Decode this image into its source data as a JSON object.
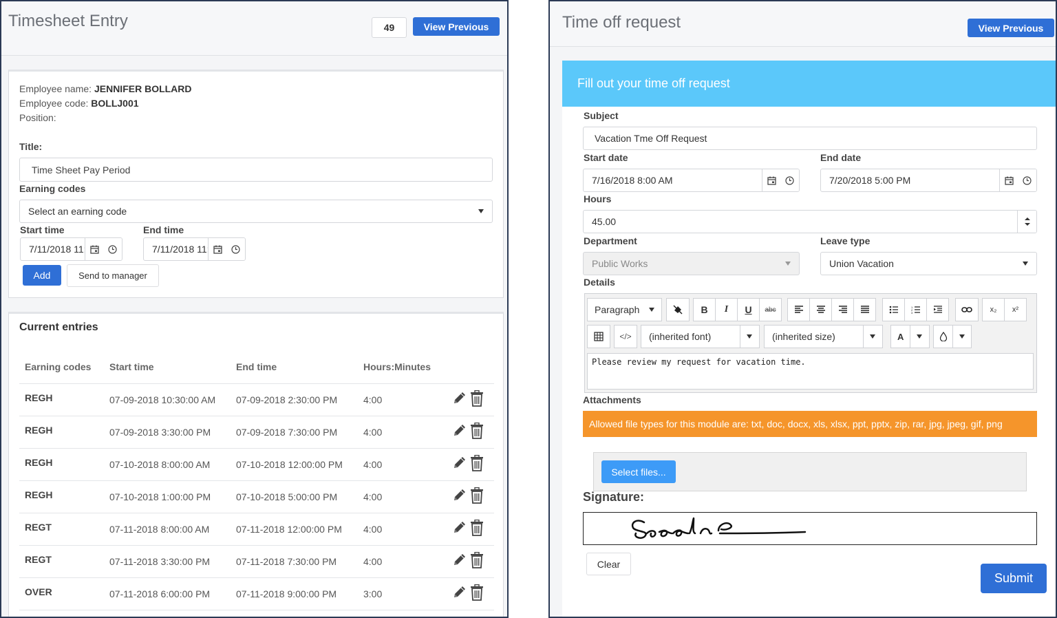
{
  "timesheet": {
    "title": "Timesheet Entry",
    "count": "49",
    "view_previous": "View Previous",
    "employee_name_label": "Employee name:",
    "employee_name": "JENNIFER BOLLARD",
    "employee_code_label": "Employee code:",
    "employee_code": "BOLLJ001",
    "position_label": "Position:",
    "title_label": "Title:",
    "title_value": "Time Sheet Pay Period",
    "earning_codes_label": "Earning codes",
    "earning_codes_placeholder": "Select an earning code",
    "start_time_label": "Start time",
    "start_time_value": "7/11/2018 11:",
    "end_time_label": "End time",
    "end_time_value": "7/11/2018 11:",
    "add_label": "Add",
    "send_label": "Send to manager",
    "current_entries_label": "Current entries",
    "columns": [
      "Earning codes",
      "Start time",
      "End time",
      "Hours:Minutes"
    ],
    "rows": [
      {
        "code": "REGH",
        "start": "07-09-2018 10:30:00 AM",
        "end": "07-09-2018 2:30:00 PM",
        "hours": "4:00"
      },
      {
        "code": "REGH",
        "start": "07-09-2018 3:30:00 PM",
        "end": "07-09-2018 7:30:00 PM",
        "hours": "4:00"
      },
      {
        "code": "REGH",
        "start": "07-10-2018 8:00:00 AM",
        "end": "07-10-2018 12:00:00 PM",
        "hours": "4:00"
      },
      {
        "code": "REGH",
        "start": "07-10-2018 1:00:00 PM",
        "end": "07-10-2018 5:00:00 PM",
        "hours": "4:00"
      },
      {
        "code": "REGT",
        "start": "07-11-2018 8:00:00 AM",
        "end": "07-11-2018 12:00:00 PM",
        "hours": "4:00"
      },
      {
        "code": "REGT",
        "start": "07-11-2018 3:30:00 PM",
        "end": "07-11-2018 7:30:00 PM",
        "hours": "4:00"
      },
      {
        "code": "OVER",
        "start": "07-11-2018 6:00:00 PM",
        "end": "07-11-2018 9:00:00 PM",
        "hours": "3:00"
      }
    ]
  },
  "timeoff": {
    "title": "Time off request",
    "view_previous": "View Previous",
    "banner": "Fill out your time off request",
    "subject_label": "Subject",
    "subject_value": "Vacation Tme Off Request",
    "start_date_label": "Start date",
    "start_date_value": "7/16/2018 8:00 AM",
    "end_date_label": "End date",
    "end_date_value": "7/20/2018 5:00 PM",
    "hours_label": "Hours",
    "hours_value": "45.00",
    "department_label": "Department",
    "department_value": "Public Works",
    "leave_type_label": "Leave type",
    "leave_type_value": "Union Vacation",
    "details_label": "Details",
    "toolbar": {
      "format": "Paragraph",
      "font": "(inherited font)",
      "size": "(inherited size)",
      "bold": "B",
      "italic": "I",
      "underline": "U",
      "strike": "abc",
      "font_color": "A",
      "subscript": "x₂",
      "superscript": "x²",
      "code": "</>"
    },
    "details_text": "Please review my request for vacation time.",
    "attachments_label": "Attachments",
    "allowed_types": "Allowed file types for this module are: txt, doc, docx, xls, xlsx, ppt, pptx, zip, rar, jpg, jpeg, gif, png",
    "select_files": "Select files...",
    "signature_label": "Signature:",
    "clear_label": "Clear",
    "submit_label": "Submit"
  },
  "colors": {
    "primary": "#2f6fd6",
    "banner": "#5bc8fa",
    "warning": "#f5952b",
    "panel_border": "#2b3a55"
  }
}
